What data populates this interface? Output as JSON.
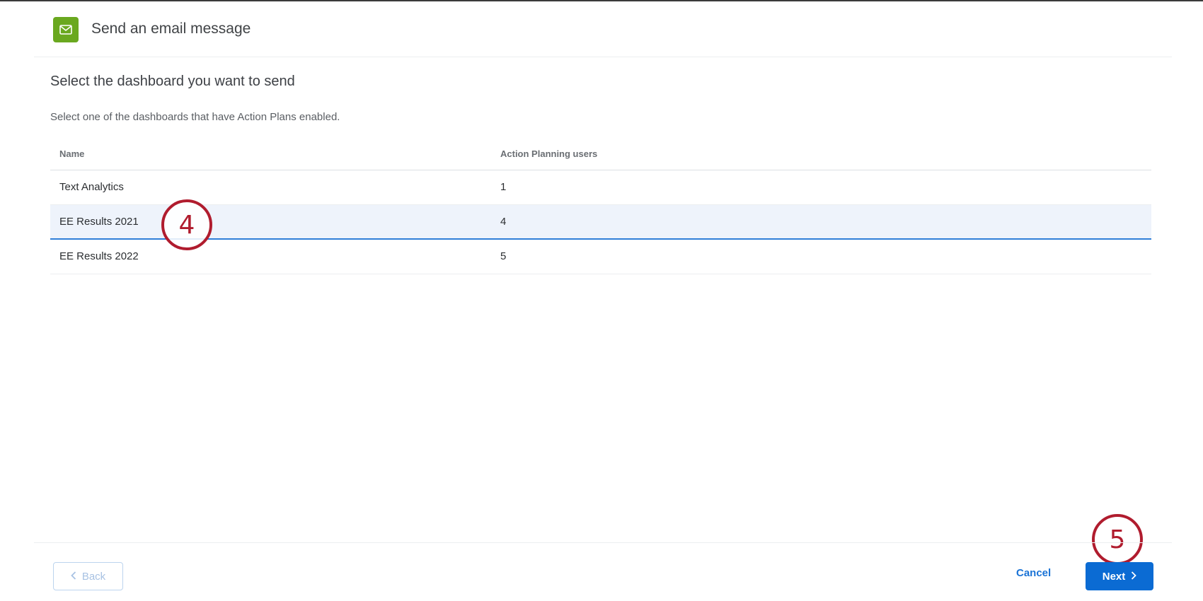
{
  "header": {
    "title": "Send an email message",
    "icon": "mail-icon"
  },
  "section": {
    "title": "Select the dashboard you want to send",
    "description": "Select one of the dashboards that have Action Plans enabled."
  },
  "table": {
    "columns": [
      "Name",
      "Action Planning users"
    ],
    "rows": [
      {
        "name": "Text Analytics",
        "users": "1",
        "selected": false
      },
      {
        "name": "EE Results 2021",
        "users": "4",
        "selected": true
      },
      {
        "name": "EE Results 2022",
        "users": "5",
        "selected": false
      }
    ]
  },
  "callouts": {
    "step4": "4",
    "step5": "5"
  },
  "footer": {
    "back_label": "Back",
    "cancel_label": "Cancel",
    "next_label": "Next"
  },
  "colors": {
    "accent": "#0b6bd3",
    "icon_bg": "#6aa81f",
    "callout": "#b01c2e",
    "selected_row": "#eef3fb"
  }
}
